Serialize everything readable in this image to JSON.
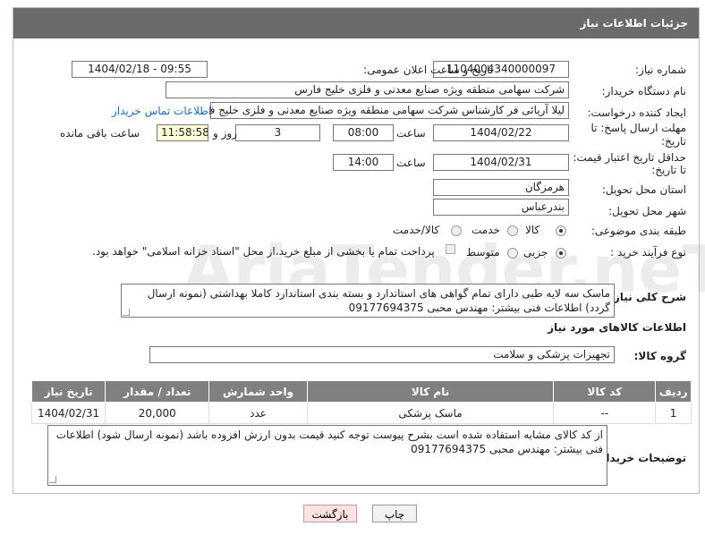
{
  "header": {
    "title": "جزئیات اطلاعات نیاز"
  },
  "form": {
    "need_number_label": "شماره نیاز:",
    "need_number": "1104004340000097",
    "announce_label": "تاریخ و ساعت اعلان عمومی:",
    "announce_value": "1404/02/18 - 09:55",
    "buyer_label": "نام دستگاه خریدار:",
    "buyer_value": "شرکت سهامی منطقه ویژه صنایع معدنی و فلزی خلیج فارس",
    "creator_label": "ایجاد کننده درخواست:",
    "creator_value": "لیلا آریائی فر کارشناس شرکت سهامی منطقه ویژه صنایع معدنی و فلزی خلیج فارس",
    "contact_link": "اطلاعات تماس خریدار",
    "deadline_label_1": "مهلت ارسال پاسخ: تا",
    "deadline_label_2": "تاریخ:",
    "deadline_date": "1404/02/22",
    "time_label": "ساعت",
    "deadline_time": "08:00",
    "days_value": "3",
    "days_label": "روز و",
    "remaining_time": "11:58:58",
    "remaining_label": "ساعت باقی مانده",
    "price_label_1": "حداقل تاریخ اعتبار قیمت:",
    "price_label_2": "تا تاریخ:",
    "price_date": "1404/02/31",
    "price_time": "14:00",
    "province_label": "استان محل تحویل:",
    "province_value": "هرمزگان",
    "city_label": "شهر محل تحویل:",
    "city_value": "بندرعباس",
    "category_label": "طبقه بندی موضوعی:",
    "category_options": [
      "کالا",
      "خدمت",
      "کالا/خدمت"
    ],
    "category_selected": "کالا",
    "process_label": "نوع فرآیند خرید :",
    "process_options": [
      "جزیی",
      "متوسط"
    ],
    "process_selected": "جزیی",
    "payment_note": "پرداخت تمام یا بخشی از مبلغ خرید،از محل \"اسناد خزانه اسلامی\" خواهد بود."
  },
  "general_desc": {
    "label": "شرح کلی نیاز:",
    "text": "ماسک سه لایه طبی دارای تمام گواهی های استاندارد و بسته بندی استاندارد کاملا بهداشتی (نمونه ارسال گردد) اطلاعات فنی بیشتر: مهندس محبی 09177694375"
  },
  "goods_info": {
    "title": "اطلاعات کالاهای مورد نیاز",
    "group_label": "گروه کالا:",
    "group_value": "تجهیزات پزشکی و سلامت"
  },
  "table": {
    "headers": [
      "ردیف",
      "کد کالا",
      "نام کالا",
      "واحد شمارش",
      "تعداد / مقدار",
      "تاریخ نیاز"
    ],
    "rows": [
      [
        "1",
        "--",
        "ماسک پزشکی",
        "عدد",
        "20,000",
        "1404/02/31"
      ]
    ]
  },
  "buyer_notes": {
    "label": "توضیحات خریدار:",
    "text": "از کد کالای مشابه استفاده شده است بشرح پیوست توجه کنید قیمت بدون ارزش افزوده باشد (نمونه ارسال شود) اطلاعات فنی بیشتر: مهندس محبی 09177694375"
  },
  "buttons": {
    "print": "چاپ",
    "back": "بازگشت"
  },
  "watermark": "AriaTender.neT"
}
